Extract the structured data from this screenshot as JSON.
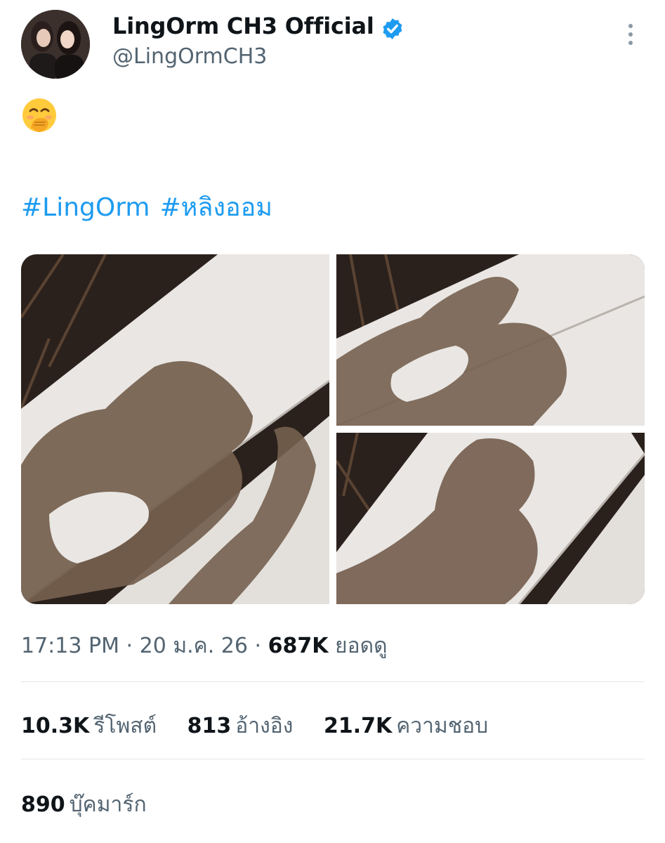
{
  "tweet": {
    "display_name": "LingOrm CH3 Official",
    "handle": "@LingOrmCH3",
    "emoji": "🤭",
    "hashtags": [
      "#LingOrm",
      "#หลิงออม"
    ],
    "time": "17:13 PM",
    "date": "20 ม.ค. 26",
    "views_count": "687K",
    "views_label": "ยอดดู",
    "separator": "·"
  },
  "stats": {
    "reposts": {
      "count": "10.3K",
      "label": "รีโพสต์"
    },
    "quotes": {
      "count": "813",
      "label": "อ้างอิง"
    },
    "likes": {
      "count": "21.7K",
      "label": "ความชอบ"
    },
    "bookmarks": {
      "count": "890",
      "label": "บุ๊คมาร์ก"
    }
  },
  "icons": {
    "verified": "verified-badge-icon",
    "more": "more-vertical-icon"
  },
  "colors": {
    "accent": "#1d9bf0",
    "text": "#0f1419",
    "secondary": "#536471"
  }
}
